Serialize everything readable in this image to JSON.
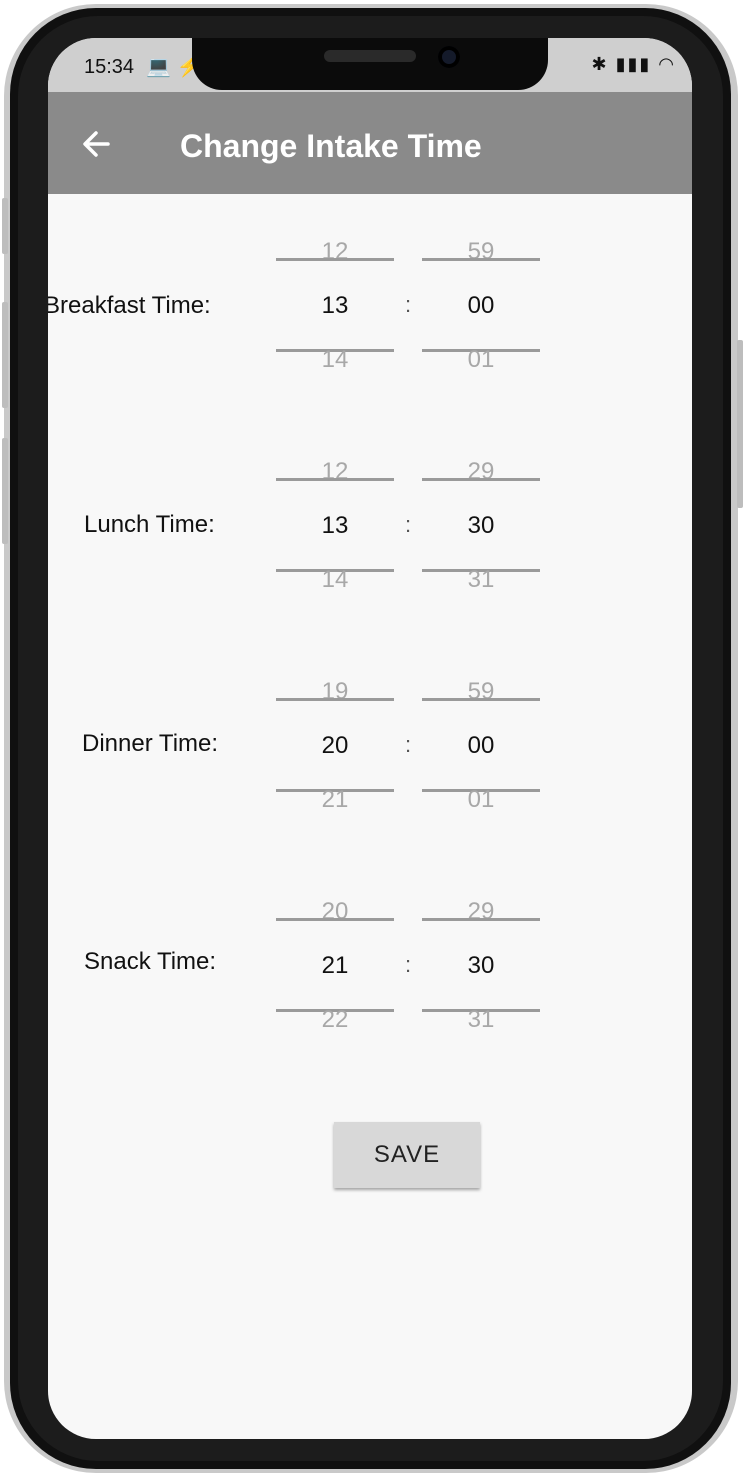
{
  "status_bar": {
    "time": "15:34",
    "left_icons": "💻 ⚡",
    "right_icons": "✱ ▮▮▮ ◠"
  },
  "app_bar": {
    "title": "Change Intake Time",
    "back_icon": "arrow-left-icon"
  },
  "meals": [
    {
      "label": "Breakfast Time:",
      "hour": {
        "prev": "12",
        "current": "13",
        "next": "14"
      },
      "minute": {
        "prev": "59",
        "current": "00",
        "next": "01"
      }
    },
    {
      "label": "Lunch Time:",
      "hour": {
        "prev": "12",
        "current": "13",
        "next": "14"
      },
      "minute": {
        "prev": "29",
        "current": "30",
        "next": "31"
      }
    },
    {
      "label": "Dinner Time:",
      "hour": {
        "prev": "19",
        "current": "20",
        "next": "21"
      },
      "minute": {
        "prev": "59",
        "current": "00",
        "next": "01"
      }
    },
    {
      "label": "Snack Time:",
      "hour": {
        "prev": "20",
        "current": "21",
        "next": "22"
      },
      "minute": {
        "prev": "29",
        "current": "30",
        "next": "31"
      }
    }
  ],
  "separator": ":",
  "save_label": "SAVE",
  "colors": {
    "app_bar": "#8a8a8a",
    "screen_bg": "#f8f8f8",
    "button_bg": "#d8d8d8"
  }
}
